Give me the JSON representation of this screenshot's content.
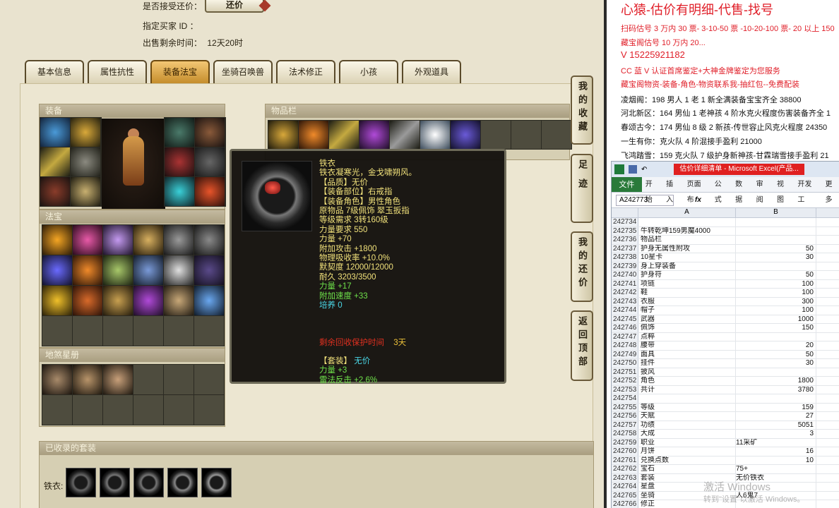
{
  "game": {
    "accept_counter_label": "是否接受还价：",
    "counter_button": "还价",
    "buyer_id_label": "指定买家 ID ：",
    "remaining_label": "出售剩余时间：",
    "remaining_value": "12天20时",
    "tabs": [
      {
        "label": "基本信息",
        "active": false
      },
      {
        "label": "属性抗性",
        "active": false
      },
      {
        "label": "装备法宝",
        "active": true
      },
      {
        "label": "坐骑召唤兽",
        "active": false
      },
      {
        "label": "法术修正",
        "active": false
      },
      {
        "label": "小孩",
        "active": false
      },
      {
        "label": "外观道具",
        "active": false
      }
    ],
    "sections": {
      "equipment": "装备",
      "treasure": "法宝",
      "inventory": "物品栏",
      "tiansha": "地煞星册",
      "collected_suits": "已收录的套装"
    },
    "suit_label": "铁衣:",
    "side_buttons": [
      {
        "label": "我的收藏"
      },
      {
        "label": "足迹"
      },
      {
        "label": "我的还价"
      },
      {
        "label": "返回顶部"
      }
    ],
    "tooltip": {
      "lines": [
        {
          "text": "铁衣",
          "color": "c-y"
        },
        {
          "text": "铁衣凝寒光，金戈啸朔风。",
          "color": "c-y"
        },
        {
          "text": "【品质】无价",
          "color": "c-y"
        },
        {
          "text": "【装备部位】右戒指",
          "color": "c-y"
        },
        {
          "text": "【装备角色】男性角色",
          "color": "c-y"
        },
        {
          "text": "原物品 7级佩饰 翠玉扳指",
          "color": "c-y"
        },
        {
          "text": "等级需求 3转160级",
          "color": "c-y"
        },
        {
          "text": "力量要求 550",
          "color": "c-y"
        },
        {
          "text": "力量 +70",
          "color": "c-y"
        },
        {
          "text": "附加攻击 +1800",
          "color": "c-y"
        },
        {
          "text": "物理吸收率 +10.0%",
          "color": "c-y"
        },
        {
          "text": "默契度 12000/12000",
          "color": "c-y"
        },
        {
          "text": "耐久 3203/3500",
          "color": "c-y"
        },
        {
          "text": "力量 +17",
          "color": "c-g"
        },
        {
          "text": "附加速度 +33",
          "color": "c-g"
        },
        {
          "text": "培养 0",
          "color": "c-c"
        },
        {
          "text": "",
          "color": "c-w"
        },
        {
          "text": "",
          "color": "c-w"
        },
        {
          "text": "",
          "color": "c-w"
        }
      ],
      "protect_label": "剩余回收保护时间",
      "protect_value": "3天",
      "suit_label": "【套装】",
      "suit_value": "无价",
      "suit_lines": [
        "力量 +3",
        "雷法反击 +2.6%"
      ]
    }
  },
  "document": {
    "title": "心猿-估价有明细-代售-找号",
    "lines": [
      {
        "text": "扫码估号 3 万内 30 票- 3-10-50 票  -10-20-100 票- 20 以上 150",
        "color": "#e0202a"
      },
      {
        "text": "藏宝阁估号 10 万内 20...",
        "color": "#e0202a"
      },
      {
        "text": "V 15225921182",
        "color": "#e0202a"
      },
      {
        "text": "CC 蓝 V 认证首席鉴定+大神金牌鉴定为您服务",
        "color": "#e0202a"
      },
      {
        "text": "藏宝阁物资-装备-角色-物资联系我-抽红包--免费配装",
        "color": "#e0202a"
      },
      {
        "text": "凌烟阁：198 男人 1 老 1 新全满装备宝宝齐全 38800",
        "color": "#111111"
      },
      {
        "text": "河北新区：164 男仙 1 老神孩 4 阶水克火程度伤害装备齐全 1",
        "color": "#111111"
      },
      {
        "text": "春颂古今：174 男仙 8 级 2 新孩-传世容止风克火程度 24350",
        "color": "#111111"
      },
      {
        "text": "一生有你：克火队 4 阶混接手盈利 21000",
        "color": "#111111"
      },
      {
        "text": "飞鸿踏雪：159 克火队 7 级护身新神孩-甘霖瑞雪接手盈利 21",
        "color": "#111111"
      }
    ]
  },
  "excel": {
    "title": "估价详细清单 - Microsoft Excel(产品...",
    "ribbon": [
      "文件",
      "开始",
      "插入",
      "页面布",
      "公式",
      "数据",
      "审阅",
      "视图",
      "开发工",
      "更多"
    ],
    "namebox": "A242773",
    "fx": "fx",
    "col_a": "A",
    "col_b": "B",
    "rows": [
      {
        "n": "242734",
        "a": "",
        "b": ""
      },
      {
        "n": "242735",
        "a": "牛转乾坤159男魔4000",
        "b": ""
      },
      {
        "n": "242736",
        "a": "物品栏",
        "b": ""
      },
      {
        "n": "242737",
        "a": "护身无属性附攻",
        "b": "50"
      },
      {
        "n": "242738",
        "a": "10星卡",
        "b": "30"
      },
      {
        "n": "242739",
        "a": "身上穿装备",
        "b": ""
      },
      {
        "n": "242740",
        "a": "护身符",
        "b": "50"
      },
      {
        "n": "242741",
        "a": "项链",
        "b": "100"
      },
      {
        "n": "242742",
        "a": "鞋",
        "b": "100"
      },
      {
        "n": "242743",
        "a": "衣服",
        "b": "300"
      },
      {
        "n": "242744",
        "a": "帽子",
        "b": "100"
      },
      {
        "n": "242745",
        "a": "武器",
        "b": "1000"
      },
      {
        "n": "242746",
        "a": "佩饰",
        "b": "150"
      },
      {
        "n": "242747",
        "a": "点粹",
        "b": ""
      },
      {
        "n": "242748",
        "a": "腰带",
        "b": "20"
      },
      {
        "n": "242749",
        "a": "面具",
        "b": "50"
      },
      {
        "n": "242750",
        "a": "挂件",
        "b": "30"
      },
      {
        "n": "242751",
        "a": "披风",
        "b": ""
      },
      {
        "n": "242752",
        "a": "角色",
        "b": "1800"
      },
      {
        "n": "242753",
        "a": "共计",
        "b": "3780"
      },
      {
        "n": "242754",
        "a": "",
        "b": ""
      },
      {
        "n": "242755",
        "a": "等级",
        "b": "159"
      },
      {
        "n": "242756",
        "a": "天赋",
        "b": "27"
      },
      {
        "n": "242757",
        "a": "功绩",
        "b": "5051"
      },
      {
        "n": "242758",
        "a": "大成",
        "b": "3"
      },
      {
        "n": "242759",
        "a": "职业",
        "b": "11采矿"
      },
      {
        "n": "242760",
        "a": "月饼",
        "b": "16"
      },
      {
        "n": "242761",
        "a": "兑换点数",
        "b": "10"
      },
      {
        "n": "242762",
        "a": "宝石",
        "b": "75+"
      },
      {
        "n": "242763",
        "a": "套装",
        "b": "无价铁衣"
      },
      {
        "n": "242764",
        "a": "星盘",
        "b": ""
      },
      {
        "n": "242765",
        "a": "坐骑",
        "b": "人6鬼7"
      },
      {
        "n": "242766",
        "a": "修正",
        "b": ""
      }
    ],
    "watermark": "激活 Windows",
    "watermark_sub": "转到\"设置\"以激活 Windows。"
  }
}
